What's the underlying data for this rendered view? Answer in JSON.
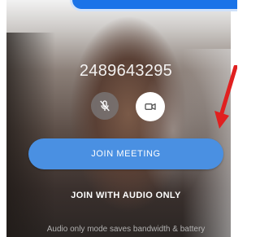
{
  "meeting": {
    "id": "2489643295"
  },
  "controls": {
    "mic_icon": "mic-off-icon",
    "camera_icon": "video-camera-icon"
  },
  "actions": {
    "join_label": "JOIN MEETING",
    "audio_only_label": "JOIN WITH AUDIO ONLY",
    "audio_only_note": "Audio only mode saves bandwidth & battery"
  },
  "colors": {
    "accent": "#1a73e8",
    "join_button": "#4a90e2",
    "annotation_arrow": "#e02020"
  }
}
